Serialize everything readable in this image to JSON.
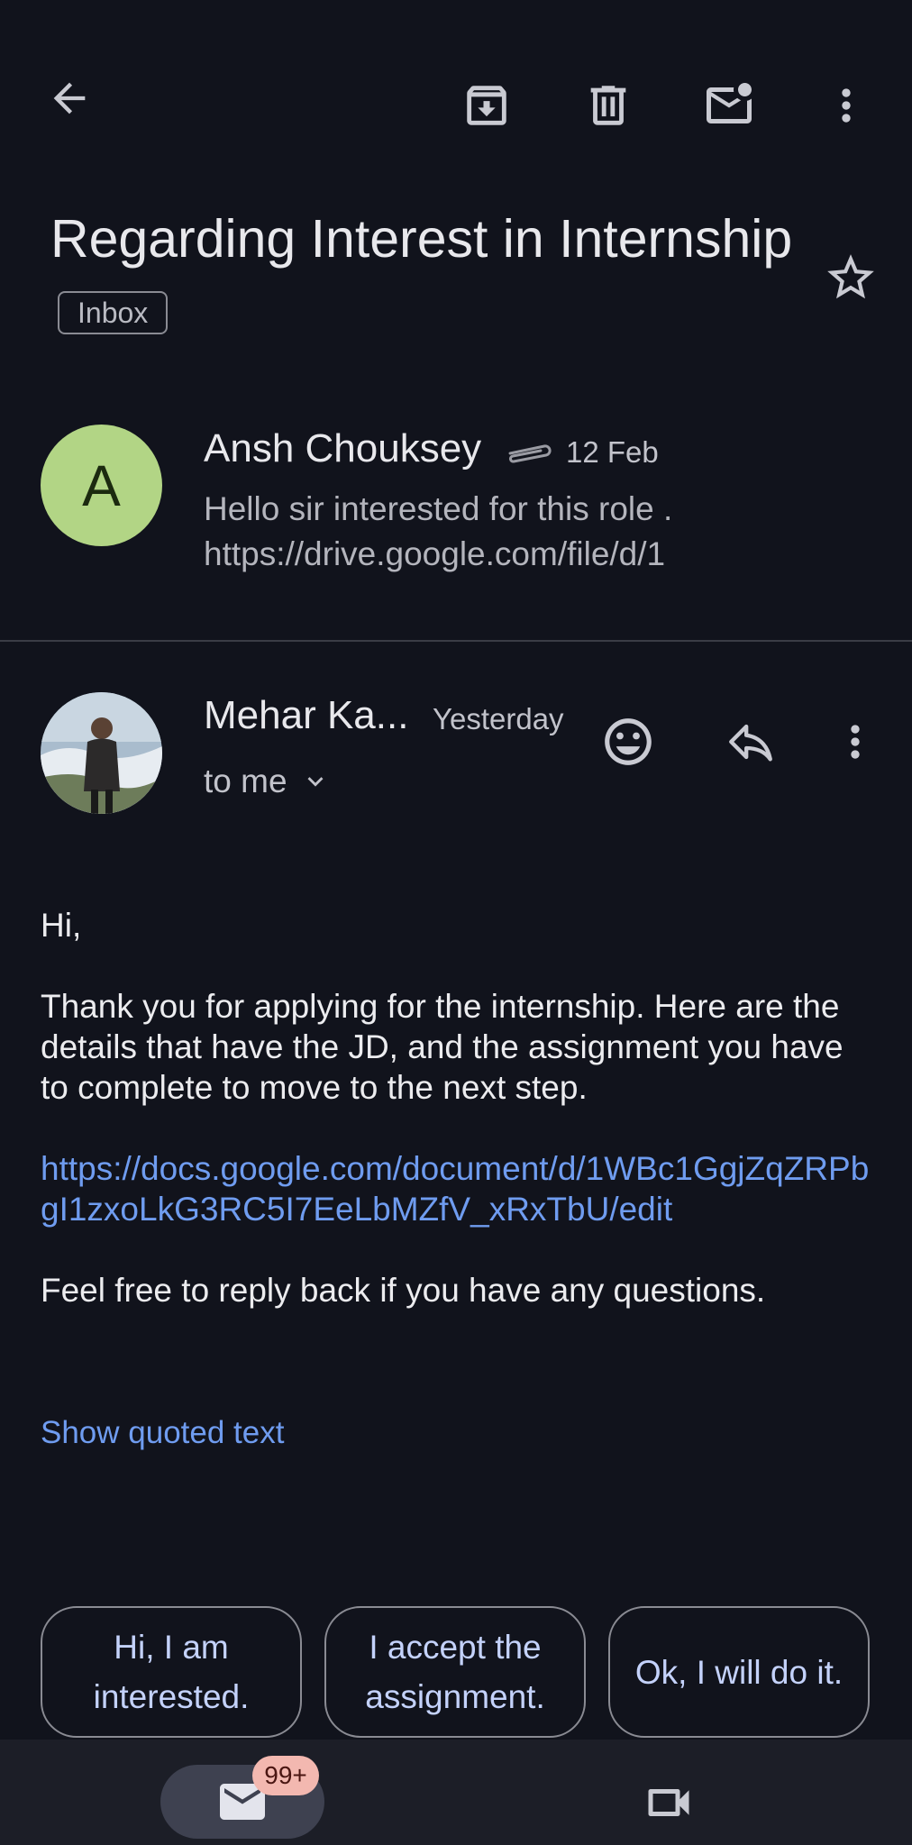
{
  "toolbar": {
    "back_icon": "arrow-back-icon",
    "archive_icon": "archive-icon",
    "delete_icon": "trash-icon",
    "mark_unread_icon": "mail-unread-icon",
    "more_icon": "more-vert-icon"
  },
  "subject": {
    "title": "Regarding Interest in Internship",
    "label": "Inbox",
    "star_icon": "star-outline-icon"
  },
  "messages": [
    {
      "avatar_letter": "A",
      "sender": "Ansh Chouksey",
      "attachment_icon": "paperclip-icon",
      "date": "12 Feb",
      "snippet": "Hello sir interested for this role . https://drive.google.com/file/d/1"
    },
    {
      "sender": "Mehar Ka...",
      "date": "Yesterday",
      "recipient": "to me",
      "emoji_icon": "emoji-react-icon",
      "reply_icon": "reply-icon",
      "more_icon": "more-vert-icon",
      "body": {
        "greeting": "Hi,",
        "paragraph1": "Thank you for applying for the internship. Here are the details that have the JD, and the assignment you have to complete to move to the next step.",
        "link": "https://docs.google.com/document/d/1WBc1GgjZqZRPbgI1zxoLkG3RC5I7EeLbMZfV_xRxTbU/edit",
        "paragraph2": "Feel free to reply back if you have any questions."
      },
      "show_quoted": "Show quoted text"
    }
  ],
  "smart_replies": [
    "Hi, I am interested.",
    "I accept the assignment.",
    "Ok, I will do it."
  ],
  "bottom_nav": {
    "mail_icon": "mail-icon",
    "mail_badge": "99+",
    "meet_icon": "video-camera-icon"
  },
  "colors": {
    "background": "#11131c",
    "link": "#6f9cf0",
    "avatar_green": "#b2d585",
    "badge": "#f3b8b0"
  }
}
